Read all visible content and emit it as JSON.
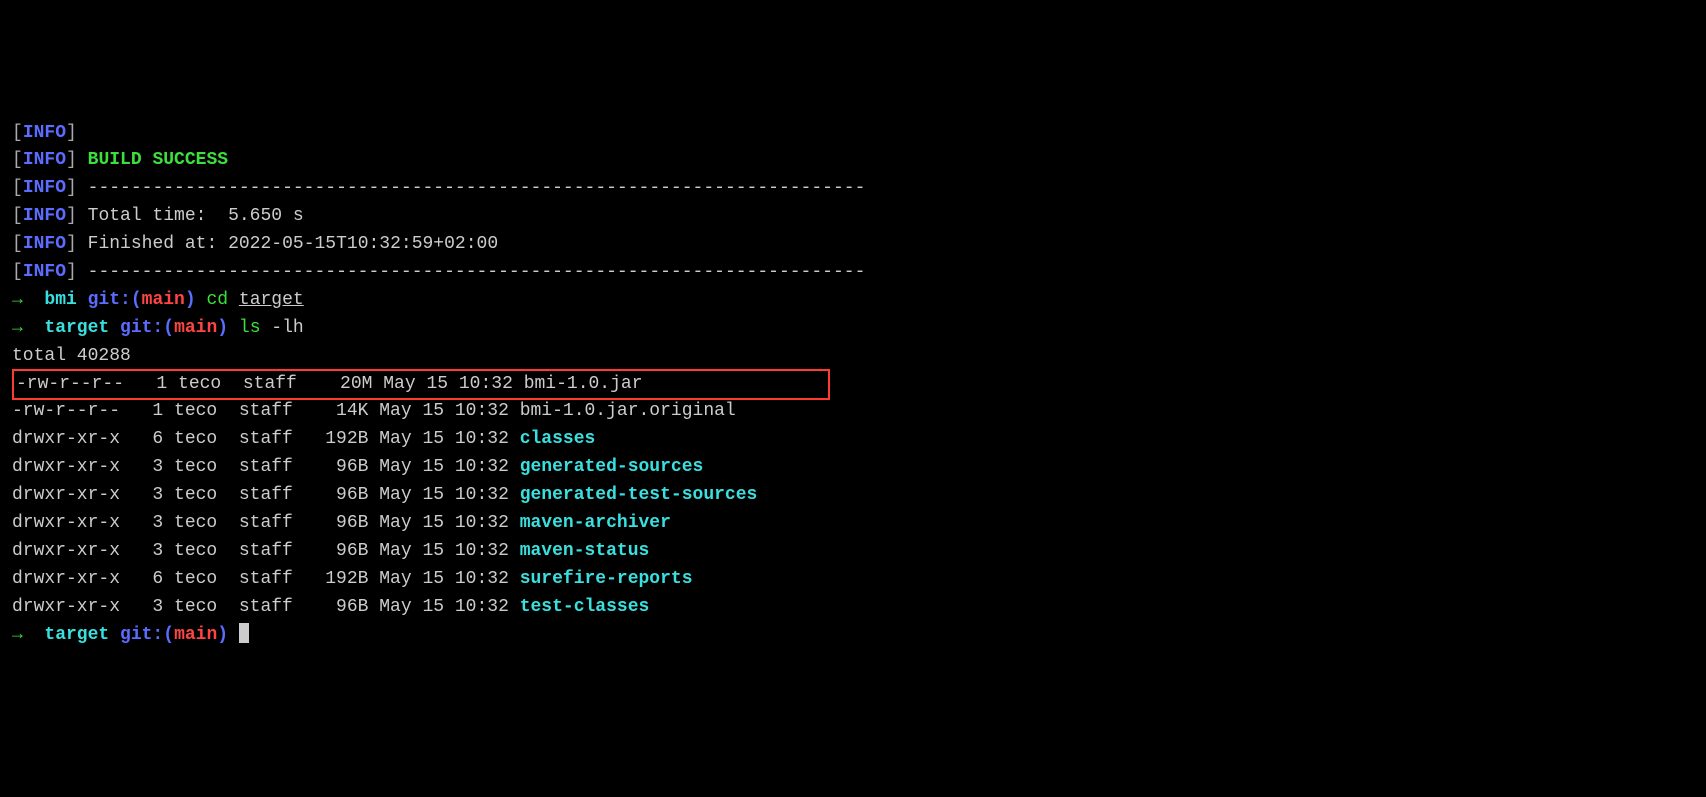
{
  "build": {
    "info_tag": "INFO",
    "success": "BUILD SUCCESS",
    "separator": "------------------------------------------------------------------------",
    "total_time_label": "Total time:  ",
    "total_time_value": "5.650 s",
    "finished_label": "Finished at: ",
    "finished_value": "2022-05-15T10:32:59+02:00"
  },
  "prompt1": {
    "arrow": "→",
    "dir": "bmi",
    "git": "git:",
    "branch": "main",
    "cmd": "cd",
    "arg": "target"
  },
  "prompt2": {
    "arrow": "→",
    "dir": "target",
    "git": "git:",
    "branch": "main",
    "cmd": "ls",
    "arg": "-lh"
  },
  "ls_total": "total 40288",
  "files": [
    {
      "perm": "-rw-r--r--",
      "links": "1",
      "owner": "teco",
      "group": "staff",
      "size": " 20M",
      "date": "May 15 10:32",
      "name": "bmi-1.0.jar",
      "is_dir": false,
      "hl": true
    },
    {
      "perm": "-rw-r--r--",
      "links": "1",
      "owner": "teco",
      "group": "staff",
      "size": " 14K",
      "date": "May 15 10:32",
      "name": "bmi-1.0.jar.original",
      "is_dir": false,
      "hl": false
    },
    {
      "perm": "drwxr-xr-x",
      "links": "6",
      "owner": "teco",
      "group": "staff",
      "size": "192B",
      "date": "May 15 10:32",
      "name": "classes",
      "is_dir": true,
      "hl": false
    },
    {
      "perm": "drwxr-xr-x",
      "links": "3",
      "owner": "teco",
      "group": "staff",
      "size": " 96B",
      "date": "May 15 10:32",
      "name": "generated-sources",
      "is_dir": true,
      "hl": false
    },
    {
      "perm": "drwxr-xr-x",
      "links": "3",
      "owner": "teco",
      "group": "staff",
      "size": " 96B",
      "date": "May 15 10:32",
      "name": "generated-test-sources",
      "is_dir": true,
      "hl": false
    },
    {
      "perm": "drwxr-xr-x",
      "links": "3",
      "owner": "teco",
      "group": "staff",
      "size": " 96B",
      "date": "May 15 10:32",
      "name": "maven-archiver",
      "is_dir": true,
      "hl": false
    },
    {
      "perm": "drwxr-xr-x",
      "links": "3",
      "owner": "teco",
      "group": "staff",
      "size": " 96B",
      "date": "May 15 10:32",
      "name": "maven-status",
      "is_dir": true,
      "hl": false
    },
    {
      "perm": "drwxr-xr-x",
      "links": "6",
      "owner": "teco",
      "group": "staff",
      "size": "192B",
      "date": "May 15 10:32",
      "name": "surefire-reports",
      "is_dir": true,
      "hl": false
    },
    {
      "perm": "drwxr-xr-x",
      "links": "3",
      "owner": "teco",
      "group": "staff",
      "size": " 96B",
      "date": "May 15 10:32",
      "name": "test-classes",
      "is_dir": true,
      "hl": false
    }
  ],
  "prompt3": {
    "arrow": "→",
    "dir": "target",
    "git": "git:",
    "branch": "main"
  }
}
